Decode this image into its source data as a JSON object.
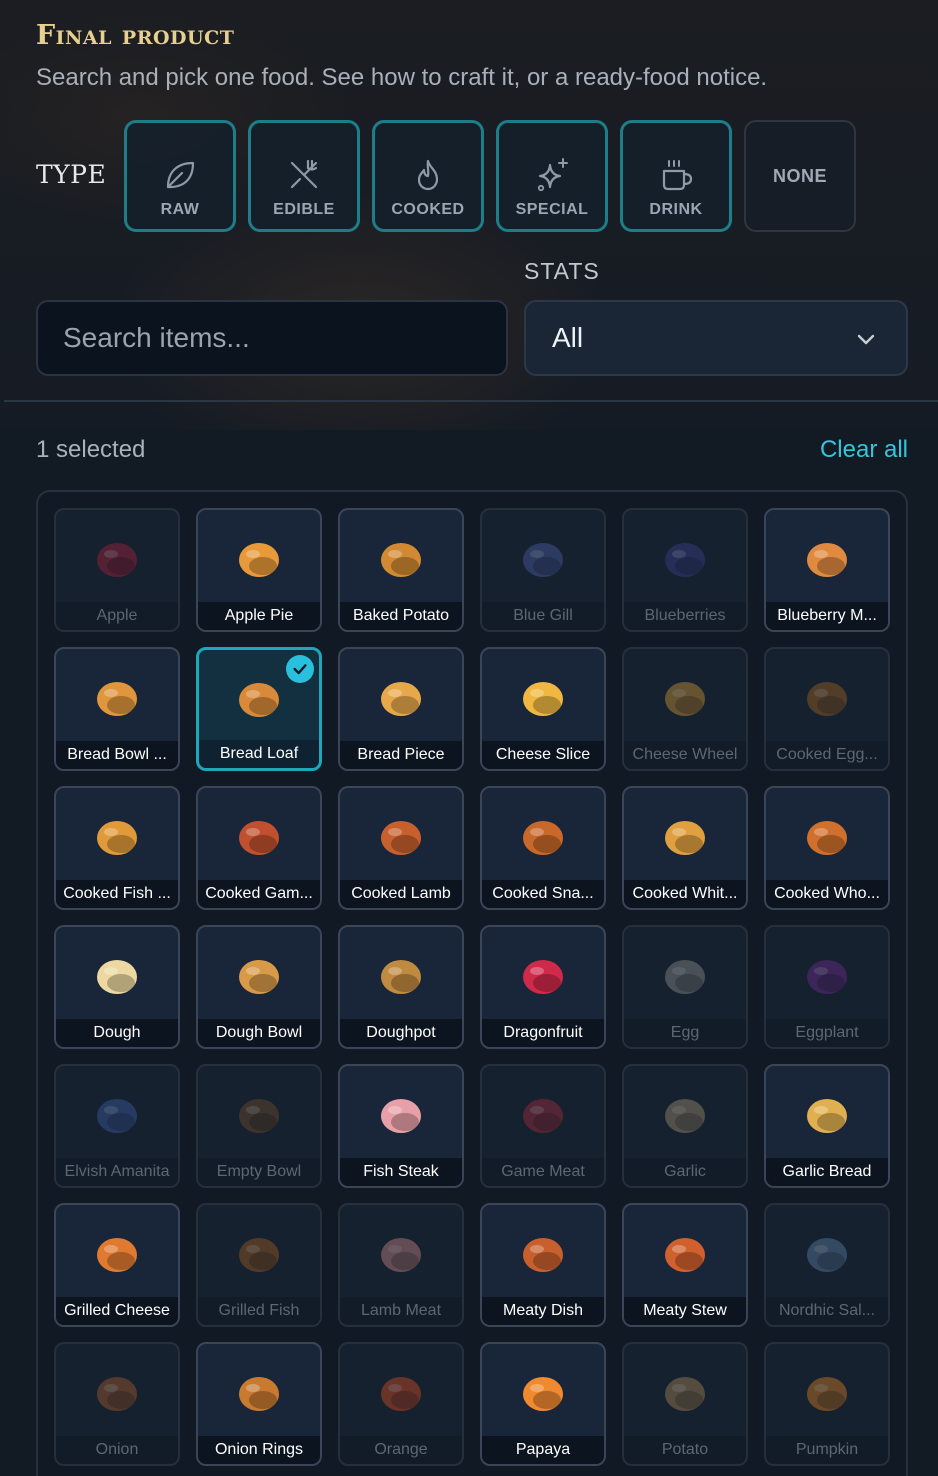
{
  "header": {
    "title": "Final product",
    "subtitle": "Search and pick one food. See how to craft it, or a ready-food notice."
  },
  "type_filter": {
    "label": "TYPE",
    "buttons": [
      {
        "label": "RAW",
        "icon": "leaf-icon",
        "active": true
      },
      {
        "label": "EDIBLE",
        "icon": "fork-knife-icon",
        "active": true
      },
      {
        "label": "COOKED",
        "icon": "flame-icon",
        "active": true
      },
      {
        "label": "SPECIAL",
        "icon": "sparkle-icon",
        "active": true
      },
      {
        "label": "DRINK",
        "icon": "cup-icon",
        "active": true
      },
      {
        "label": "NONE",
        "icon": "",
        "active": false
      }
    ]
  },
  "stats": {
    "label": "STATS",
    "selected": "All"
  },
  "search": {
    "placeholder": "Search items...",
    "value": ""
  },
  "selection": {
    "count_text": "1 selected",
    "clear_label": "Clear all"
  },
  "colors": {
    "accent": "#28c0dc",
    "title_gold": "#e7cf8f",
    "border_active": "#1d7e88"
  },
  "items": [
    {
      "name": "Apple",
      "state": "dim",
      "icon": "apple-icon",
      "color": "#a0203a"
    },
    {
      "name": "Apple Pie",
      "state": "avail",
      "icon": "pie-icon",
      "color": "#e89a3a"
    },
    {
      "name": "Baked Potato",
      "state": "avail",
      "icon": "potato-icon",
      "color": "#d18a32"
    },
    {
      "name": "Blue Gill",
      "state": "dim",
      "icon": "fish-icon",
      "color": "#4a5aa0"
    },
    {
      "name": "Blueberries",
      "state": "dim",
      "icon": "berries-icon",
      "color": "#3a3f8a"
    },
    {
      "name": "Blueberry M...",
      "state": "avail",
      "icon": "muffin-icon",
      "color": "#e08a40"
    },
    {
      "name": "Bread Bowl ...",
      "state": "avail",
      "icon": "bowl-icon",
      "color": "#e0963c"
    },
    {
      "name": "Bread Loaf",
      "state": "sel",
      "icon": "bread-icon",
      "color": "#d88a3a"
    },
    {
      "name": "Bread Piece",
      "state": "avail",
      "icon": "bread-piece-icon",
      "color": "#e6a84a"
    },
    {
      "name": "Cheese Slice",
      "state": "avail",
      "icon": "cheese-icon",
      "color": "#f0b840"
    },
    {
      "name": "Cheese Wheel",
      "state": "dim",
      "icon": "cheese-wheel-icon",
      "color": "#c89030"
    },
    {
      "name": "Cooked Egg...",
      "state": "dim",
      "icon": "eggplant-icon",
      "color": "#9a6020"
    },
    {
      "name": "Cooked Fish ...",
      "state": "avail",
      "icon": "fish-cooked-icon",
      "color": "#e09a3a"
    },
    {
      "name": "Cooked Gam...",
      "state": "avail",
      "icon": "meat-icon",
      "color": "#c0502e"
    },
    {
      "name": "Cooked Lamb",
      "state": "avail",
      "icon": "lamb-icon",
      "color": "#c8602e"
    },
    {
      "name": "Cooked Sna...",
      "state": "avail",
      "icon": "drumstick-icon",
      "color": "#c8682a"
    },
    {
      "name": "Cooked Whit...",
      "state": "avail",
      "icon": "pieces-icon",
      "color": "#e0a040"
    },
    {
      "name": "Cooked Who...",
      "state": "avail",
      "icon": "drumstick-icon",
      "color": "#d0702c"
    },
    {
      "name": "Dough",
      "state": "avail",
      "icon": "dough-icon",
      "color": "#ecd8a0"
    },
    {
      "name": "Dough Bowl",
      "state": "avail",
      "icon": "bowl-icon",
      "color": "#d89a48"
    },
    {
      "name": "Doughpot",
      "state": "avail",
      "icon": "bowl-icon",
      "color": "#c08a40"
    },
    {
      "name": "Dragonfruit",
      "state": "avail",
      "icon": "dragonfruit-icon",
      "color": "#d02a4a"
    },
    {
      "name": "Egg",
      "state": "dim",
      "icon": "egg-icon",
      "color": "#8a8a8a"
    },
    {
      "name": "Eggplant",
      "state": "dim",
      "icon": "eggplant-icon",
      "color": "#6a2a8a"
    },
    {
      "name": "Elvish Amanita",
      "state": "dim",
      "icon": "mushroom-icon",
      "color": "#3a5aa0"
    },
    {
      "name": "Empty Bowl",
      "state": "dim",
      "icon": "bowl-icon",
      "color": "#6a4a2a"
    },
    {
      "name": "Fish Steak",
      "state": "avail",
      "icon": "steak-icon",
      "color": "#e8a0a8"
    },
    {
      "name": "Game Meat",
      "state": "dim",
      "icon": "meat-icon",
      "color": "#a02a3a"
    },
    {
      "name": "Garlic",
      "state": "dim",
      "icon": "garlic-icon",
      "color": "#9a8a6a"
    },
    {
      "name": "Garlic Bread",
      "state": "avail",
      "icon": "garlic-bread-icon",
      "color": "#e0b050"
    },
    {
      "name": "Grilled Cheese",
      "state": "avail",
      "icon": "grilled-cheese-icon",
      "color": "#e07a30"
    },
    {
      "name": "Grilled Fish",
      "state": "dim",
      "icon": "drumstick-icon",
      "color": "#9a5a20"
    },
    {
      "name": "Lamb Meat",
      "state": "dim",
      "icon": "lamb-leg-icon",
      "color": "#c08080"
    },
    {
      "name": "Meaty Dish",
      "state": "avail",
      "icon": "dish-icon",
      "color": "#c8602e"
    },
    {
      "name": "Meaty Stew",
      "state": "avail",
      "icon": "dish-icon",
      "color": "#d0602e"
    },
    {
      "name": "Nordhic Sal...",
      "state": "dim",
      "icon": "fish-icon",
      "color": "#5a7aa0"
    },
    {
      "name": "Onion",
      "state": "dim",
      "icon": "onion-icon",
      "color": "#a05a2a"
    },
    {
      "name": "Onion Rings",
      "state": "avail",
      "icon": "onion-rings-icon",
      "color": "#c87a30"
    },
    {
      "name": "Orange",
      "state": "dim",
      "icon": "orange-icon",
      "color": "#d04a20"
    },
    {
      "name": "Papaya",
      "state": "avail",
      "icon": "papaya-icon",
      "color": "#f08a30"
    },
    {
      "name": "Potato",
      "state": "dim",
      "icon": "potato-icon",
      "color": "#a08050"
    },
    {
      "name": "Pumpkin",
      "state": "dim",
      "icon": "pumpkin-icon",
      "color": "#d07a20"
    }
  ]
}
